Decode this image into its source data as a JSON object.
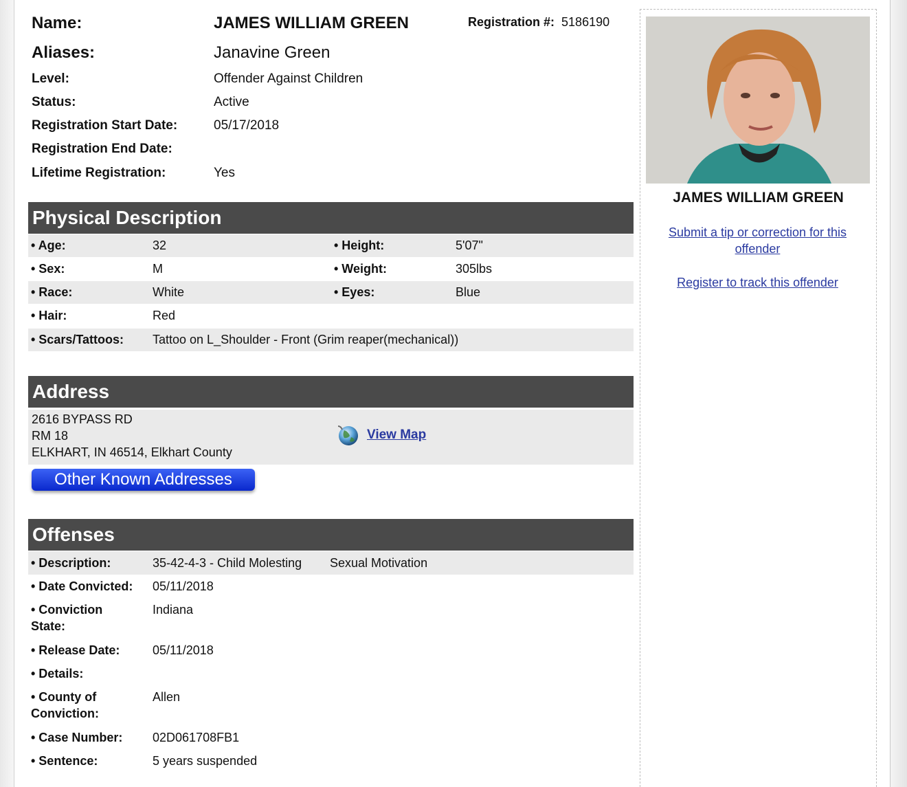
{
  "header": {
    "name_label": "Name:",
    "name_value": "JAMES WILLIAM GREEN",
    "aliases_label": "Aliases:",
    "aliases_value": "Janavine Green",
    "level_label": "Level:",
    "level_value": "Offender Against Children",
    "status_label": "Status:",
    "status_value": "Active",
    "reg_start_label": "Registration Start Date:",
    "reg_start_value": "05/17/2018",
    "reg_end_label": "Registration End Date:",
    "reg_end_value": "",
    "lifetime_label": "Lifetime Registration:",
    "lifetime_value": "Yes",
    "registration_label": "Registration #:",
    "registration_value": "5186190"
  },
  "physical": {
    "title": "Physical Description",
    "age_label": "• Age:",
    "age_value": "32",
    "height_label": "• Height:",
    "height_value": "5'07\"",
    "sex_label": "• Sex:",
    "sex_value": "M",
    "weight_label": "• Weight:",
    "weight_value": "305lbs",
    "race_label": "• Race:",
    "race_value": "White",
    "eyes_label": "• Eyes:",
    "eyes_value": "Blue",
    "hair_label": "• Hair:",
    "hair_value": "Red",
    "scars_label": "• Scars/Tattoos:",
    "scars_value": "Tattoo on L_Shoulder - Front (Grim reaper(mechanical))"
  },
  "address": {
    "title": "Address",
    "line1": "2616 BYPASS RD",
    "line2": "RM 18",
    "line3": "ELKHART, IN 46514, Elkhart County",
    "map_link": "View Map",
    "other_button": "Other Known Addresses"
  },
  "offenses": {
    "title": "Offenses",
    "description_label": "• Description:",
    "description_value": "35-42-4-3 - Child Molesting",
    "description_extra": "Sexual Motivation",
    "date_convicted_label": "• Date Convicted:",
    "date_convicted_value": "05/11/2018",
    "conviction_state_label": "• Conviction State:",
    "conviction_state_value": "Indiana",
    "release_date_label": "• Release Date:",
    "release_date_value": "05/11/2018",
    "details_label": "• Details:",
    "details_value": "",
    "county_label": "• County of Conviction:",
    "county_value": "Allen",
    "case_label": "• Case Number:",
    "case_value": "02D061708FB1",
    "sentence_label": "• Sentence:",
    "sentence_value": "5 years suspended"
  },
  "sidebar": {
    "name": "JAMES WILLIAM GREEN",
    "tip_link": "Submit a tip or correction for this offender",
    "track_link": "Register to track this offender"
  },
  "colors": {
    "section_bar": "#4a4a4a",
    "row_shade": "#eaeaea",
    "link": "#2a3aa0",
    "button": "#0a28cc"
  }
}
